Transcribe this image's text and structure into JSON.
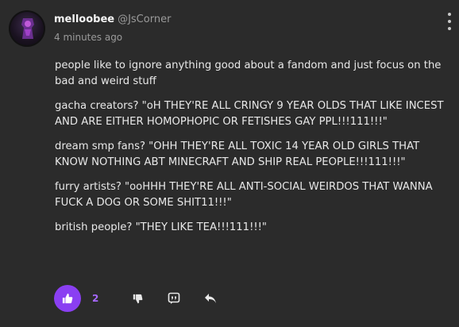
{
  "post": {
    "username": "melloobee",
    "handle": "@JsCorner",
    "timestamp": "4 minutes ago",
    "paragraphs": [
      "people like to ignore anything good about a fandom and just focus on the bad and weird stuff",
      "gacha creators? \"oH THEY'RE ALL CRINGY 9 YEAR OLDS THAT LIKE INCEST AND ARE EITHER HOMOPHOPIC OR FETISHES GAY PPL!!!111!!!\"",
      "dream smp fans? \"OHH THEY'RE ALL TOXIC 14 YEAR OLD GIRLS THAT KNOW NOTHING ABT MINECRAFT AND SHIP REAL PEOPLE!!!111!!!\"",
      "furry artists? \"ooHHH THEY'RE ALL ANTI-SOCIAL WEIRDOS THAT WANNA FUCK A DOG OR SOME SHIT11!!!\"",
      "british people? \"THEY LIKE TEA!!!111!!!\""
    ]
  },
  "actions": {
    "like_count": "2",
    "icons": [
      "thumbs-up-icon",
      "thumbs-down-icon",
      "quote-icon",
      "reply-icon"
    ]
  },
  "colors": {
    "background": "#2b2b2b",
    "accent": "#8a3ff2",
    "accent_text": "#a768ff",
    "muted": "#9a9a9a"
  }
}
